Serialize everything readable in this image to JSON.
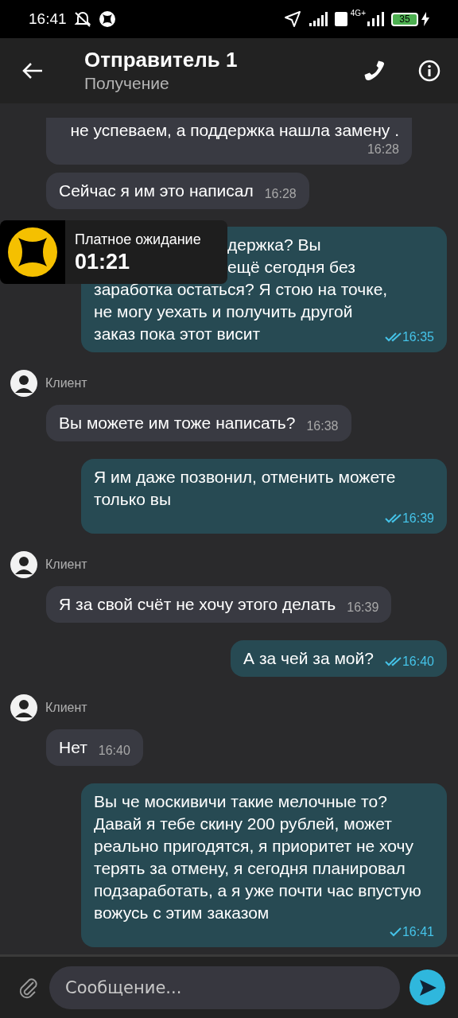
{
  "status_bar": {
    "time": "16:41",
    "battery": "35",
    "network": "4G+"
  },
  "header": {
    "title": "Отправитель 1",
    "subtitle": "Получение"
  },
  "messages": [
    {
      "kind": "in",
      "text": "не успеваем, а поддержка нашла замену .",
      "time": "16:28"
    },
    {
      "kind": "in",
      "text": "Сейчас я им это написал",
      "time": "16:28"
    },
    {
      "kind": "out",
      "lines": [
        {
          "text": "держка? Вы",
          "covered": true
        },
        {
          "text": "ещё сегодня без",
          "covered": true
        },
        {
          "text": "заработка остаться? Я стою на точке,",
          "covered": false
        },
        {
          "text": "не могу уехать и получить другой",
          "covered": false
        },
        {
          "text": "заказ пока этот висит",
          "covered": false
        }
      ],
      "time": "16:35",
      "read": true
    },
    {
      "kind": "sender",
      "name": "Клиент"
    },
    {
      "kind": "in",
      "text": "Вы можете им тоже написать?",
      "time": "16:38"
    },
    {
      "kind": "out",
      "text": "Я им даже позвонил, отменить можете только вы",
      "time": "16:39",
      "read": true
    },
    {
      "kind": "sender",
      "name": "Клиент"
    },
    {
      "kind": "in",
      "text": "Я за свой счёт не хочу этого делать",
      "time": "16:39"
    },
    {
      "kind": "out",
      "text": "А за чей за мой?",
      "time": "16:40",
      "read": true
    },
    {
      "kind": "sender",
      "name": "Клиент"
    },
    {
      "kind": "in",
      "text": "Нет",
      "time": "16:40"
    },
    {
      "kind": "out",
      "text": "Вы че москивичи такие мелочные то? Давай я тебе скину 200 рублей, может реально пригодятся, я приоритет не хочу терять за отмену, я сегодня планировал подзаработать, а я уже почти час впустую вожусь с этим заказом",
      "time": "16:41",
      "read": false
    }
  ],
  "waiting_badge": {
    "label": "Платное ожидание",
    "timer": "01:21"
  },
  "composer": {
    "placeholder": "Сообщение..."
  }
}
